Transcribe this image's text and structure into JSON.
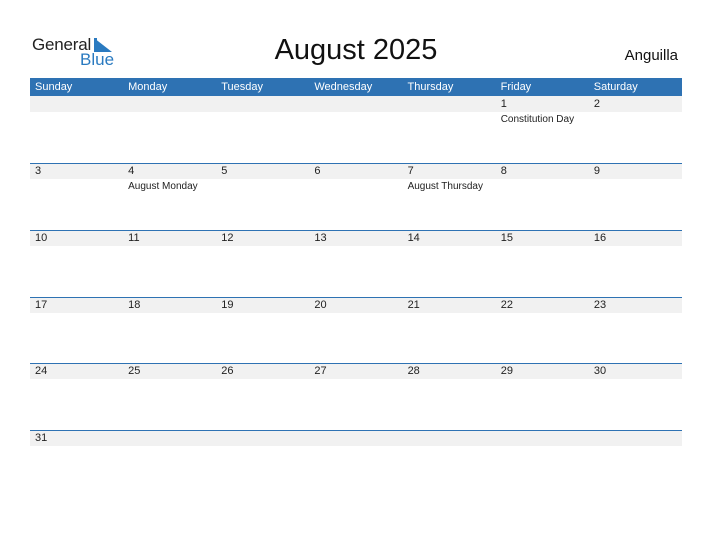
{
  "logo": {
    "general": "General",
    "blue": "Blue"
  },
  "title": "August 2025",
  "country": "Anguilla",
  "colors": {
    "accent": "#2e72b3",
    "band": "#f1f1f1"
  },
  "weekdays": [
    "Sunday",
    "Monday",
    "Tuesday",
    "Wednesday",
    "Thursday",
    "Friday",
    "Saturday"
  ],
  "weeks": [
    [
      {
        "day": "",
        "holiday": ""
      },
      {
        "day": "",
        "holiday": ""
      },
      {
        "day": "",
        "holiday": ""
      },
      {
        "day": "",
        "holiday": ""
      },
      {
        "day": "",
        "holiday": ""
      },
      {
        "day": "1",
        "holiday": "Constitution Day"
      },
      {
        "day": "2",
        "holiday": ""
      }
    ],
    [
      {
        "day": "3",
        "holiday": ""
      },
      {
        "day": "4",
        "holiday": "August Monday"
      },
      {
        "day": "5",
        "holiday": ""
      },
      {
        "day": "6",
        "holiday": ""
      },
      {
        "day": "7",
        "holiday": "August Thursday"
      },
      {
        "day": "8",
        "holiday": ""
      },
      {
        "day": "9",
        "holiday": ""
      }
    ],
    [
      {
        "day": "10",
        "holiday": ""
      },
      {
        "day": "11",
        "holiday": ""
      },
      {
        "day": "12",
        "holiday": ""
      },
      {
        "day": "13",
        "holiday": ""
      },
      {
        "day": "14",
        "holiday": ""
      },
      {
        "day": "15",
        "holiday": ""
      },
      {
        "day": "16",
        "holiday": ""
      }
    ],
    [
      {
        "day": "17",
        "holiday": ""
      },
      {
        "day": "18",
        "holiday": ""
      },
      {
        "day": "19",
        "holiday": ""
      },
      {
        "day": "20",
        "holiday": ""
      },
      {
        "day": "21",
        "holiday": ""
      },
      {
        "day": "22",
        "holiday": ""
      },
      {
        "day": "23",
        "holiday": ""
      }
    ],
    [
      {
        "day": "24",
        "holiday": ""
      },
      {
        "day": "25",
        "holiday": ""
      },
      {
        "day": "26",
        "holiday": ""
      },
      {
        "day": "27",
        "holiday": ""
      },
      {
        "day": "28",
        "holiday": ""
      },
      {
        "day": "29",
        "holiday": ""
      },
      {
        "day": "30",
        "holiday": ""
      }
    ],
    [
      {
        "day": "31",
        "holiday": ""
      },
      {
        "day": "",
        "holiday": ""
      },
      {
        "day": "",
        "holiday": ""
      },
      {
        "day": "",
        "holiday": ""
      },
      {
        "day": "",
        "holiday": ""
      },
      {
        "day": "",
        "holiday": ""
      },
      {
        "day": "",
        "holiday": ""
      }
    ]
  ]
}
